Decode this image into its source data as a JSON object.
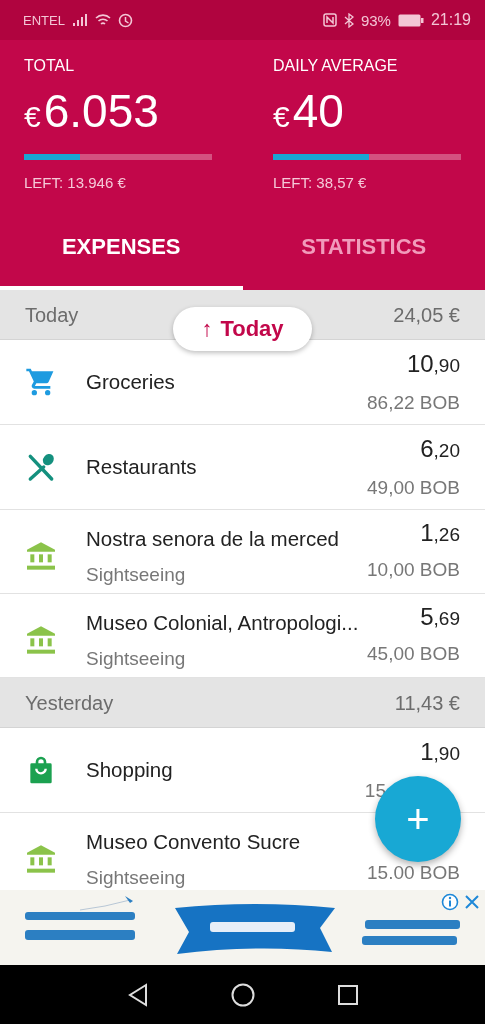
{
  "status_bar": {
    "carrier": "ENTEL",
    "battery": "93%",
    "time": "21:19"
  },
  "summary": [
    {
      "label": "TOTAL",
      "currency": "€",
      "value": "6.053",
      "level": 0.3,
      "left": "LEFT: 13.946 €"
    },
    {
      "label": "DAILY AVERAGE",
      "currency": "€",
      "value": "40",
      "level": 0.51,
      "left": "LEFT: 38,57 €"
    }
  ],
  "tabs": [
    {
      "label": "EXPENSES",
      "selected": true
    },
    {
      "label": "STATISTICS",
      "selected": false
    }
  ],
  "jump_button": {
    "icon": "↑",
    "label": "Today"
  },
  "sections": [
    {
      "title": "Today",
      "total": "24,05 €",
      "items": [
        {
          "kind": "cart",
          "color": "#1e9be0",
          "name": "Groceries",
          "amount": "10,90",
          "converted": "86,22 BOB"
        },
        {
          "kind": "cutlery",
          "color": "#14907e",
          "name": "Restaurants",
          "amount": "6,20",
          "converted": "49,00 BOB"
        },
        {
          "kind": "museum",
          "color": "#8bc34a",
          "name": "Nostra senora de la merced",
          "category": "Sightseeing",
          "amount": "1,26",
          "converted": "10,00 BOB"
        },
        {
          "kind": "museum",
          "color": "#8bc34a",
          "name": "Museo Colonial, Antropologi...",
          "category": "Sightseeing",
          "amount": "5,69",
          "converted": "45,00 BOB"
        }
      ]
    },
    {
      "title": "Yesterday",
      "total": "11,43 €",
      "items": [
        {
          "kind": "bag",
          "color": "#1ba150",
          "name": "Shopping",
          "amount": "1,90",
          "converted": "15",
          "covered": true
        },
        {
          "kind": "museum",
          "color": "#8bc34a",
          "name": "Museo Convento Sucre",
          "category": "Sightseeing",
          "converted": "15.00 BOB"
        }
      ]
    }
  ],
  "fab": {
    "label": "+"
  }
}
